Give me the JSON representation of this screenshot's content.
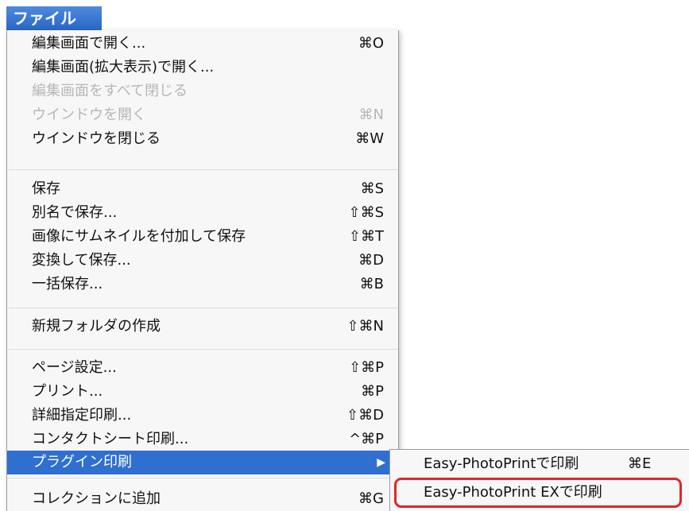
{
  "menu_title": "ファイル",
  "menu": {
    "items": [
      {
        "label": "編集画面で開く...",
        "shortcut": "⌘O"
      },
      {
        "label": "編集画面(拡大表示)で開く...",
        "shortcut": ""
      },
      {
        "label": "編集画面をすべて閉じる",
        "shortcut": ""
      },
      {
        "label": "ウインドウを開く",
        "shortcut": "⌘N"
      },
      {
        "label": "ウインドウを閉じる",
        "shortcut": "⌘W"
      },
      {
        "label": "保存",
        "shortcut": "⌘S"
      },
      {
        "label": "別名で保存...",
        "shortcut": "⇧⌘S"
      },
      {
        "label": "画像にサムネイルを付加して保存",
        "shortcut": "⇧⌘T"
      },
      {
        "label": "変換して保存...",
        "shortcut": "⌘D"
      },
      {
        "label": "一括保存...",
        "shortcut": "⌘B"
      },
      {
        "label": "新規フォルダの作成",
        "shortcut": "⇧⌘N"
      },
      {
        "label": "ページ設定...",
        "shortcut": "⇧⌘P"
      },
      {
        "label": "プリント...",
        "shortcut": "⌘P"
      },
      {
        "label": "詳細指定印刷...",
        "shortcut": "⇧⌘D"
      },
      {
        "label": "コンタクトシート印刷...",
        "shortcut": "^⌘P"
      },
      {
        "label": "プラグイン印刷",
        "shortcut": "▶"
      },
      {
        "label": "コレクションに追加",
        "shortcut": "⌘G"
      }
    ]
  },
  "submenu": {
    "items": [
      {
        "label": "Easy-PhotoPrintで印刷",
        "shortcut": "⌘E"
      },
      {
        "label": "Easy-PhotoPrint EXで印刷",
        "shortcut": ""
      }
    ]
  },
  "colors": {
    "highlight": "#2f6fd0",
    "annotation": "#e0262a",
    "disabled_text": "#b6b6b6"
  }
}
